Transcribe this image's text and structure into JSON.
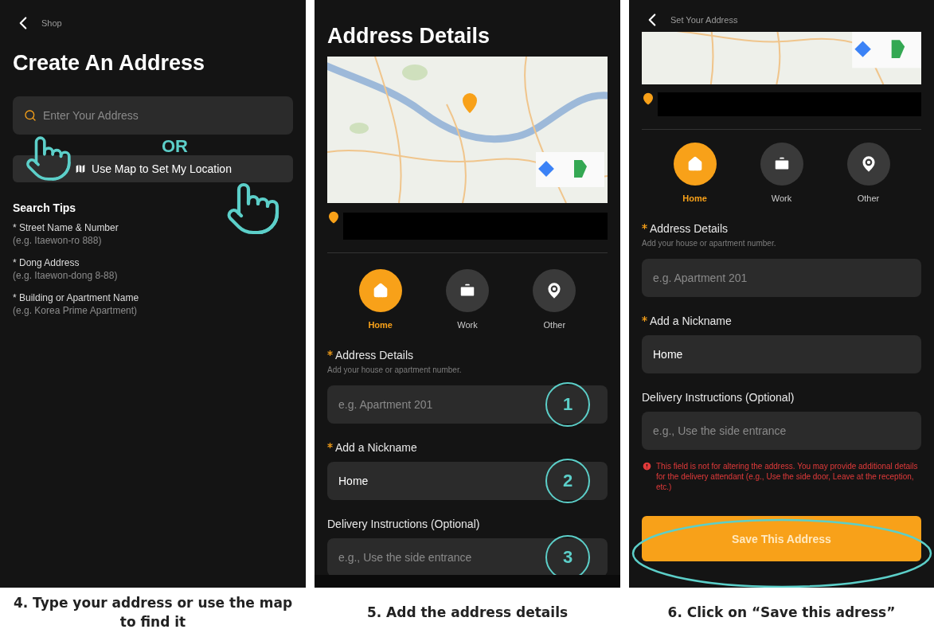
{
  "panels": [
    {
      "kind": "search",
      "back_label": "Shop",
      "title": "Create An Address",
      "search": {
        "placeholder": "Enter Your Address"
      },
      "or_label": "OR",
      "map_button": "Use Map to Set My Location",
      "tips_title": "Search Tips",
      "tips": [
        {
          "label": "* Street Name & Number",
          "example": "(e.g. Itaewon-ro 888)"
        },
        {
          "label": "* Dong Address",
          "example": "(e.g. Itaewon-dong 8-88)"
        },
        {
          "label": "* Building or Apartment Name",
          "example": "(e.g. Korea Prime Apartment)"
        }
      ],
      "caption": "4. Type your address or use the map to find it"
    },
    {
      "kind": "details",
      "title": "Address Details",
      "scrolled": false,
      "types": [
        {
          "label": "Home",
          "kind": "home",
          "selected": true
        },
        {
          "label": "Work",
          "kind": "work",
          "selected": false
        },
        {
          "label": "Other",
          "kind": "other",
          "selected": false
        }
      ],
      "fields": [
        {
          "label": "Address Details",
          "required": true,
          "hint": "Add your house or apartment number.",
          "placeholder": "e.g. Apartment 201",
          "step": "1"
        },
        {
          "label": "Add a Nickname",
          "required": true,
          "value": "Home",
          "step": "2"
        },
        {
          "label": "Delivery Instructions (Optional)",
          "required": false,
          "placeholder": "e.g., Use the side entrance",
          "step": "3"
        }
      ],
      "caption": "5. Add the address details"
    },
    {
      "kind": "details",
      "back_label": "Set Your Address",
      "scrolled": true,
      "types": [
        {
          "label": "Home",
          "kind": "home",
          "selected": true
        },
        {
          "label": "Work",
          "kind": "work",
          "selected": false
        },
        {
          "label": "Other",
          "kind": "other",
          "selected": false
        }
      ],
      "fields": [
        {
          "label": "Address Details",
          "required": true,
          "hint": "Add your house or apartment number.",
          "placeholder": "e.g. Apartment 201"
        },
        {
          "label": "Add a Nickname",
          "required": true,
          "value": "Home"
        },
        {
          "label": "Delivery Instructions (Optional)",
          "required": false,
          "placeholder": "e.g., Use the side entrance",
          "warning": "This field is not for altering the address. You may provide additional details for the delivery attendant (e.g., Use the side door, Leave at the reception, etc.)"
        }
      ],
      "save_button": "Save This Address",
      "caption": "6. Click on “Save this adress”"
    }
  ]
}
